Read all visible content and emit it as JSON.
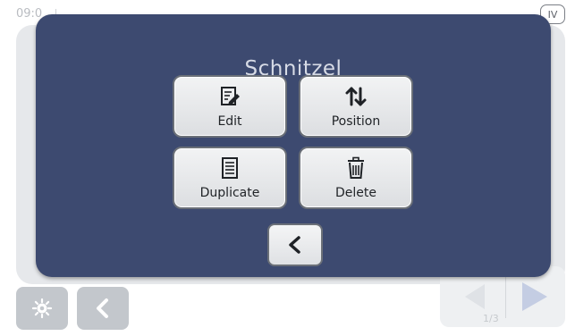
{
  "status_bar": {
    "time": "09:0",
    "badge": "IV"
  },
  "footer": {
    "page_indicator": "1/3"
  },
  "dialog": {
    "title": "Schnitzel",
    "buttons": [
      {
        "label": "Edit",
        "icon": "edit-icon"
      },
      {
        "label": "Position",
        "icon": "updown-arrows-icon"
      },
      {
        "label": "Duplicate",
        "icon": "document-icon"
      },
      {
        "label": "Delete",
        "icon": "trash-icon"
      }
    ],
    "back_icon": "chevron-left-icon"
  },
  "colors": {
    "dialog_bg": "#3d4a70",
    "button_bg": "#e6e7e9",
    "title_text": "#d7dbe6"
  }
}
